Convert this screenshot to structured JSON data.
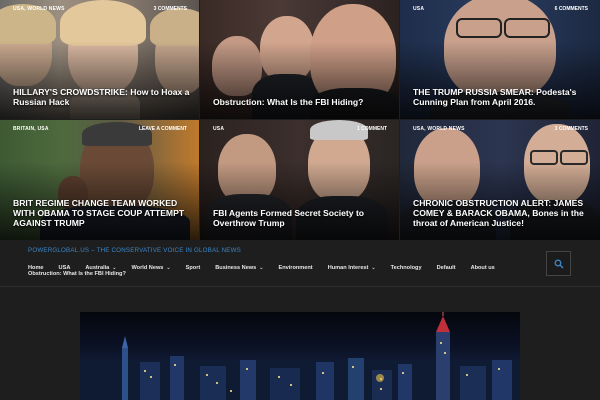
{
  "tiles": [
    {
      "categories": "USA, WORLD NEWS",
      "comments": "3 COMMENTS",
      "title": "HILLARY'S CROWDSTRIKE: How to Hoax a Russian Hack"
    },
    {
      "categories": "",
      "comments": "",
      "title": "Obstruction: What Is the FBI Hiding?"
    },
    {
      "categories": "USA",
      "comments": "6 COMMENTS",
      "title": "THE TRUMP RUSSIA SMEAR: Podesta's Cunning Plan from April 2016."
    },
    {
      "categories": "BRITAIN, USA",
      "comments": "LEAVE A COMMENT",
      "title": "BRIT REGIME CHANGE TEAM WORKED WITH OBAMA TO STAGE COUP ATTEMPT AGAINST TRUMP"
    },
    {
      "categories": "USA",
      "comments": "1 COMMENT",
      "title": "FBI Agents Formed Secret Society to Overthrow Trump"
    },
    {
      "categories": "USA, WORLD NEWS",
      "comments": "3 COMMENTS",
      "title": "CHRONIC OBSTRUCTION ALERT: JAMES COMEY & BARACK OBAMA, Bones in the throat of American Justice!"
    }
  ],
  "site": {
    "brand": "POWERGLOBAL.US – THE CONSERVATIVE VOICE IN GLOBAL NEWS"
  },
  "nav": {
    "items": [
      "Home",
      "USA",
      "Australia",
      "World News",
      "Sport",
      "Business News",
      "Environment",
      "Human Interest",
      "Technology",
      "Default",
      "About us"
    ],
    "second_line": "Obstruction: What Is the FBI Hiding?"
  },
  "icons": {
    "search": "search-icon",
    "dropdown": "chevron-down-icon"
  },
  "colors": {
    "accent": "#3a86c8",
    "background": "#1e1e1e"
  }
}
